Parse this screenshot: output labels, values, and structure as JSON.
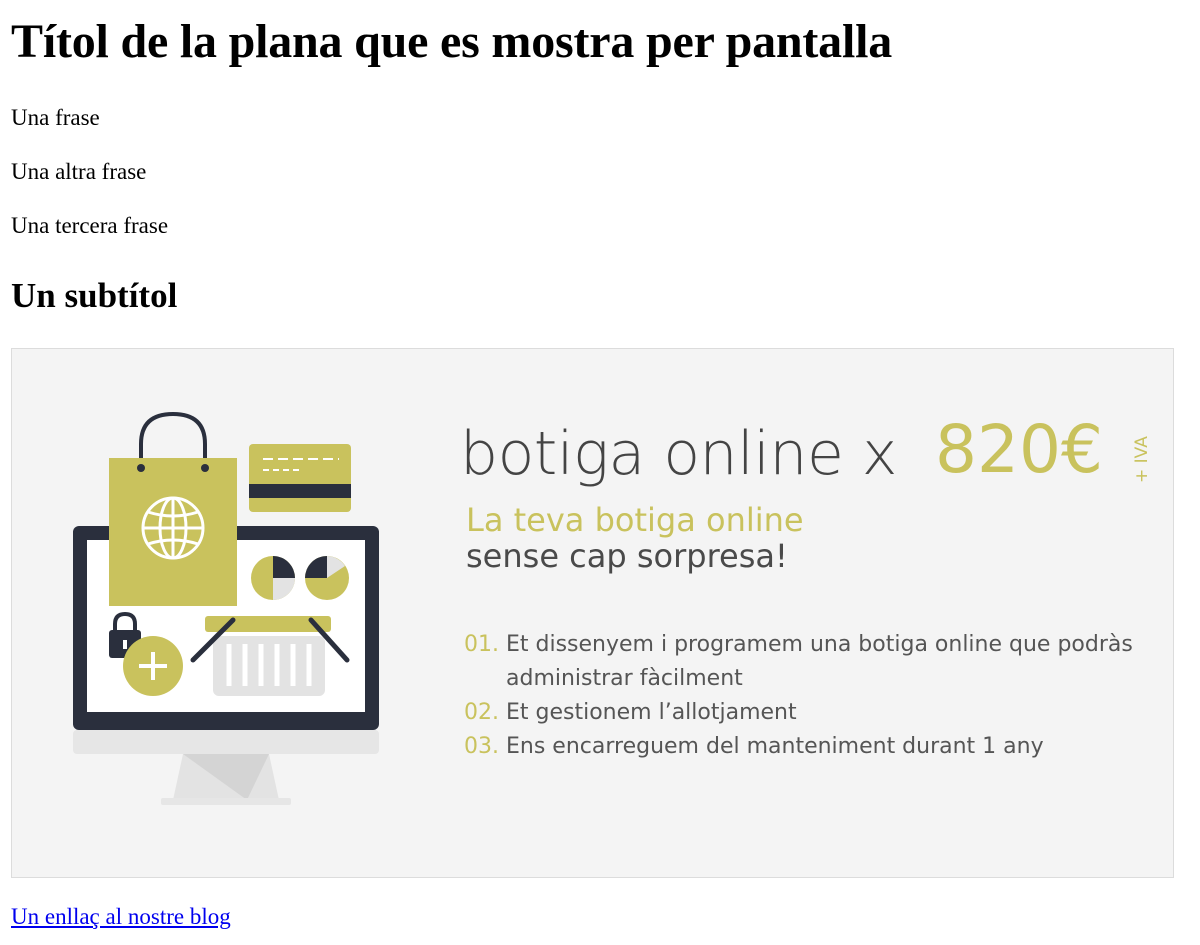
{
  "page": {
    "title": "Títol de la plana que es mostra per pantalla",
    "paragraphs": [
      "Una frase",
      "Una altra frase",
      "Una tercera frase"
    ],
    "subtitle": "Un subtítol",
    "link_text": "Un enllaç al nostre blog"
  },
  "banner": {
    "headline": "botiga online x",
    "price": "820€",
    "tax": "+ IVA",
    "tagline_accent": "La teva botiga online",
    "tagline_rest": "sense cap sorpresa!",
    "features": [
      {
        "num": "01.",
        "line1": "Et dissenyem i programem una botiga online que podràs",
        "line2": "administrar fàcilment"
      },
      {
        "num": "02.",
        "line1": "Et gestionem l’allotjament"
      },
      {
        "num": "03.",
        "line1": "Ens encarreguem del manteniment durant 1 any"
      }
    ],
    "icons": [
      "monitor-icon",
      "shopping-bag-icon",
      "globe-icon",
      "credit-card-icon",
      "pie-chart-icon",
      "lock-icon",
      "plus-icon",
      "basket-icon"
    ]
  },
  "colors": {
    "accent": "#c9c25d",
    "dark": "#2a2f3d",
    "text_gray": "#4a4a4a",
    "banner_bg": "#f4f4f4",
    "link": "#0000ee"
  }
}
